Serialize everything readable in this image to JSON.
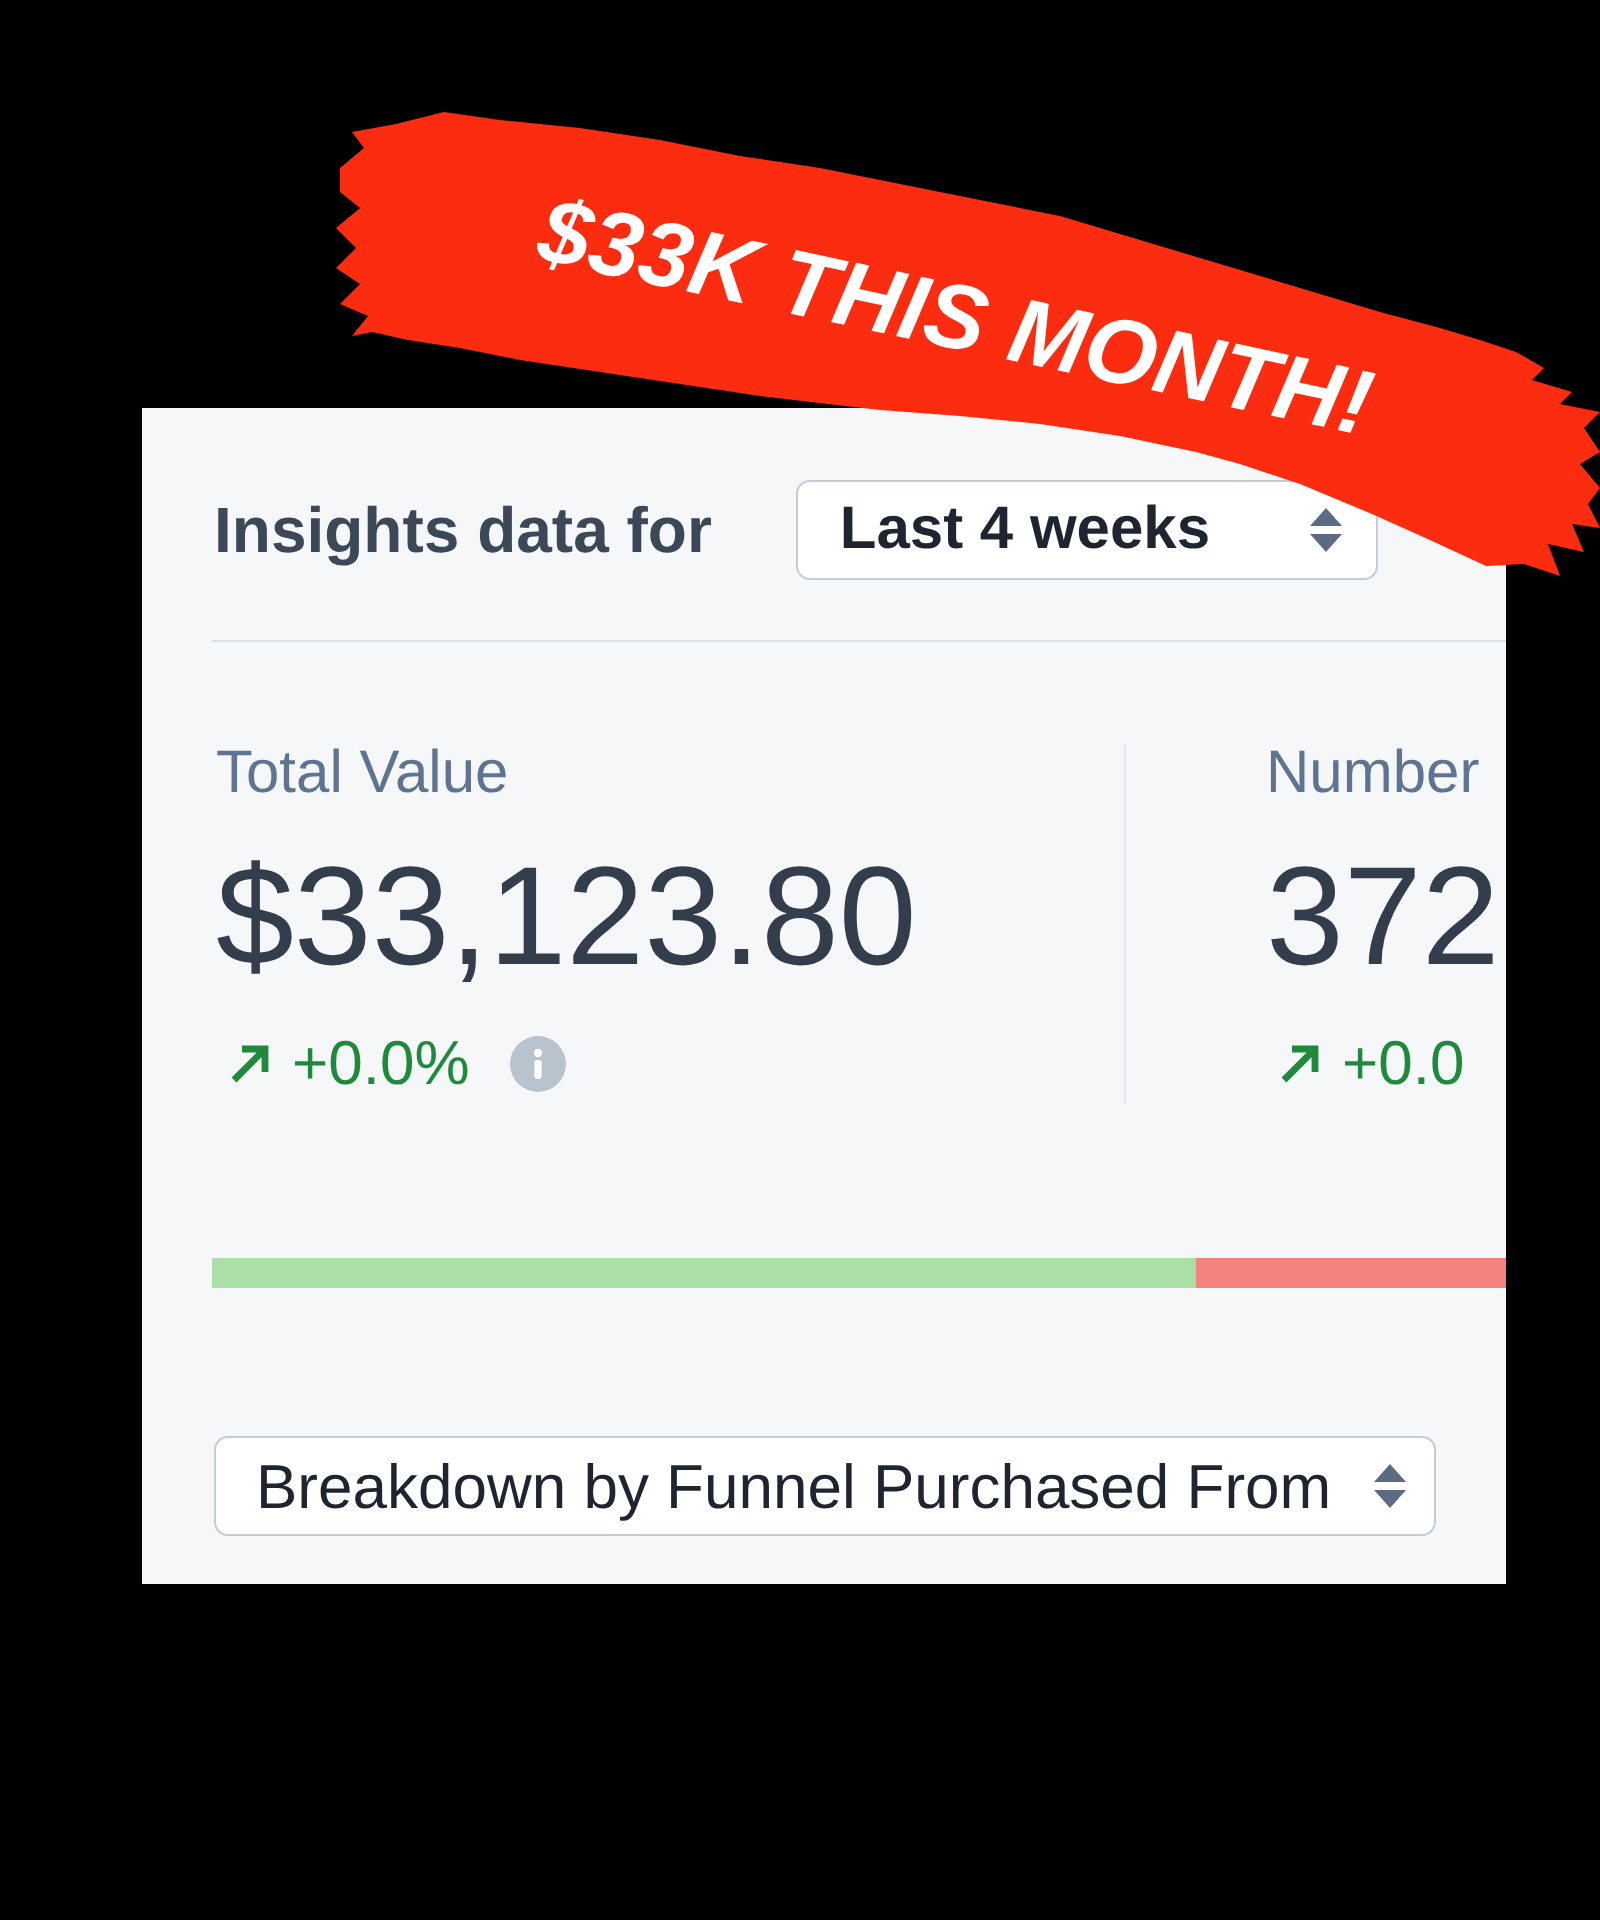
{
  "banner": {
    "text": "$33K THIS MONTH!"
  },
  "header": {
    "title": "Insights data for",
    "period_select": {
      "value": "Last 4 weeks"
    }
  },
  "stats": [
    {
      "label": "Total Value",
      "value": "$33,123.80",
      "kind": "up",
      "change": "+0.0%",
      "info": true
    },
    {
      "label": "Number",
      "value": "372",
      "kind": "up",
      "change": "+0.0"
    }
  ],
  "split_bar": {
    "level": 0.76
  },
  "breakdown_select": {
    "value": "Breakdown by Funnel Purchased From"
  }
}
